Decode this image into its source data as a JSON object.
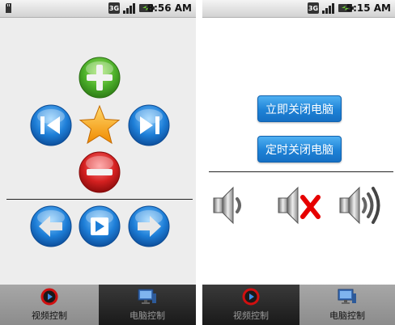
{
  "left_screen": {
    "status": {
      "time": "8:56 AM",
      "network": "3G"
    },
    "tabs": [
      {
        "label": "视频控制",
        "icon": "video-play-icon",
        "active": true
      },
      {
        "label": "电脑控制",
        "icon": "computer-monitor-icon",
        "active": false
      }
    ],
    "controls": {
      "volume_up": "plus-icon",
      "previous": "skip-previous-icon",
      "favorite": "star-icon",
      "next": "skip-next-icon",
      "volume_down": "minus-icon",
      "back": "arrow-left-icon",
      "play": "play-icon",
      "forward": "arrow-right-icon"
    }
  },
  "right_screen": {
    "status": {
      "time": "5:15 AM",
      "network": "3G"
    },
    "buttons": {
      "shutdown_now": "立即关闭电脑",
      "shutdown_timer": "定时关闭电脑"
    },
    "volume_icons": [
      "speaker-low-icon",
      "speaker-mute-icon",
      "speaker-high-icon"
    ],
    "tabs": [
      {
        "label": "视频控制",
        "icon": "video-play-icon",
        "active": false
      },
      {
        "label": "电脑控制",
        "icon": "computer-monitor-icon",
        "active": true
      }
    ]
  },
  "colors": {
    "green_button": "#4caf2a",
    "blue_button": "#1e7fd8",
    "red_button": "#d42020",
    "star": "#f5a623",
    "primary_button": "#1e82d6",
    "mute_x": "#e60000"
  }
}
